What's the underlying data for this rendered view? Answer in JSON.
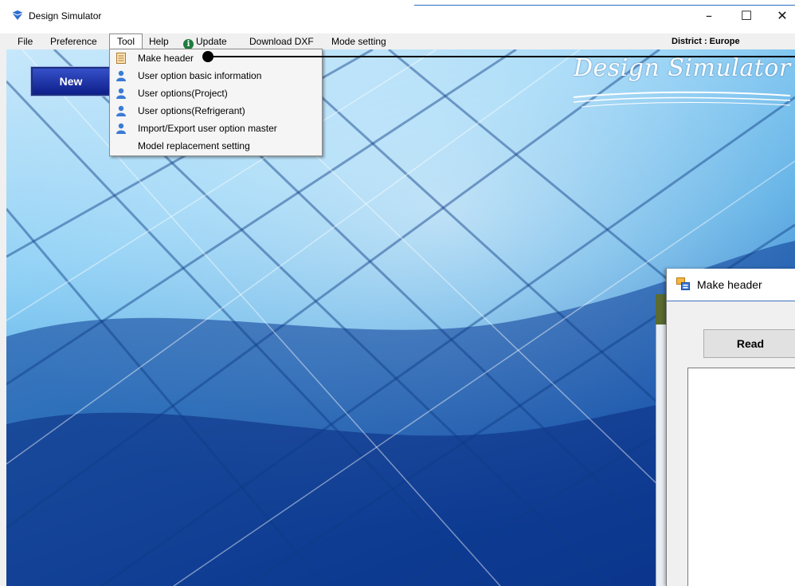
{
  "window": {
    "title": "Design Simulator",
    "controls": {
      "minimize": "–",
      "maximize": "☐",
      "close": "✕"
    }
  },
  "menubar": {
    "items": [
      "File",
      "Preference",
      "Tool",
      "Help",
      "Update",
      "Download DXF",
      "Mode setting"
    ],
    "active": "Tool",
    "district": "District : Europe"
  },
  "main": {
    "new_button": "New",
    "logo_text": "Design Simulator"
  },
  "tool_menu": {
    "items": [
      {
        "label": "Make header",
        "icon": "document-icon"
      },
      {
        "label": "User option basic information",
        "icon": "user-icon"
      },
      {
        "label": "User options(Project)",
        "icon": "user-icon"
      },
      {
        "label": "User options(Refrigerant)",
        "icon": "user-icon"
      },
      {
        "label": "Import/Export user option master",
        "icon": "user-icon"
      },
      {
        "label": "Model replacement setting",
        "icon": ""
      }
    ]
  },
  "dialog": {
    "title": "Make header",
    "read_button": "Read"
  },
  "colors": {
    "menu_bg": "#f0f0f0",
    "new_button": "#0e1f8a",
    "accent": "#2a70c4",
    "user_icon": "#3a7bd5"
  }
}
